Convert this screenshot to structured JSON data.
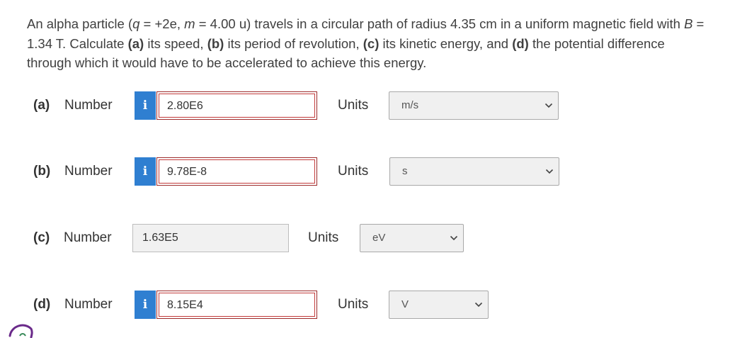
{
  "question": {
    "p1": "An alpha particle (",
    "q_var": "q",
    "p2": " = +2e, ",
    "m_var": "m",
    "p3": " = 4.00 u) travels in a circular path of radius 4.35 cm in a uniform magnetic field with ",
    "b_var": "B",
    "p4": " = 1.34 T. Calculate ",
    "a_tag": "(a)",
    "a_txt": " its speed, ",
    "b_tag": "(b)",
    "b_txt": " its period of revolution, ",
    "c_tag": "(c)",
    "c_txt": " its kinetic energy, and ",
    "d_tag": "(d)",
    "d_txt": " the potential difference through which it would have to be accelerated to achieve this energy."
  },
  "parts": [
    {
      "part": "(a)",
      "number_label": "Number",
      "info_icon": "i",
      "value": "2.80E6",
      "units_label": "Units",
      "unit": "m/s"
    },
    {
      "part": "(b)",
      "number_label": "Number",
      "info_icon": "i",
      "value": "9.78E-8",
      "units_label": "Units",
      "unit": "s"
    },
    {
      "part": "(c)",
      "number_label": "Number",
      "value": "1.63E5",
      "units_label": "Units",
      "unit": "eV"
    },
    {
      "part": "(d)",
      "number_label": "Number",
      "info_icon": "i",
      "value": "8.15E4",
      "units_label": "Units",
      "unit": "V"
    }
  ],
  "colors": {
    "info": "#2f7fd1",
    "incorrect_border": "#c23a3a",
    "select_bg": "#f0f0f0"
  },
  "icons": {
    "info": "info-icon",
    "dropdown": "chevron-down-icon"
  }
}
